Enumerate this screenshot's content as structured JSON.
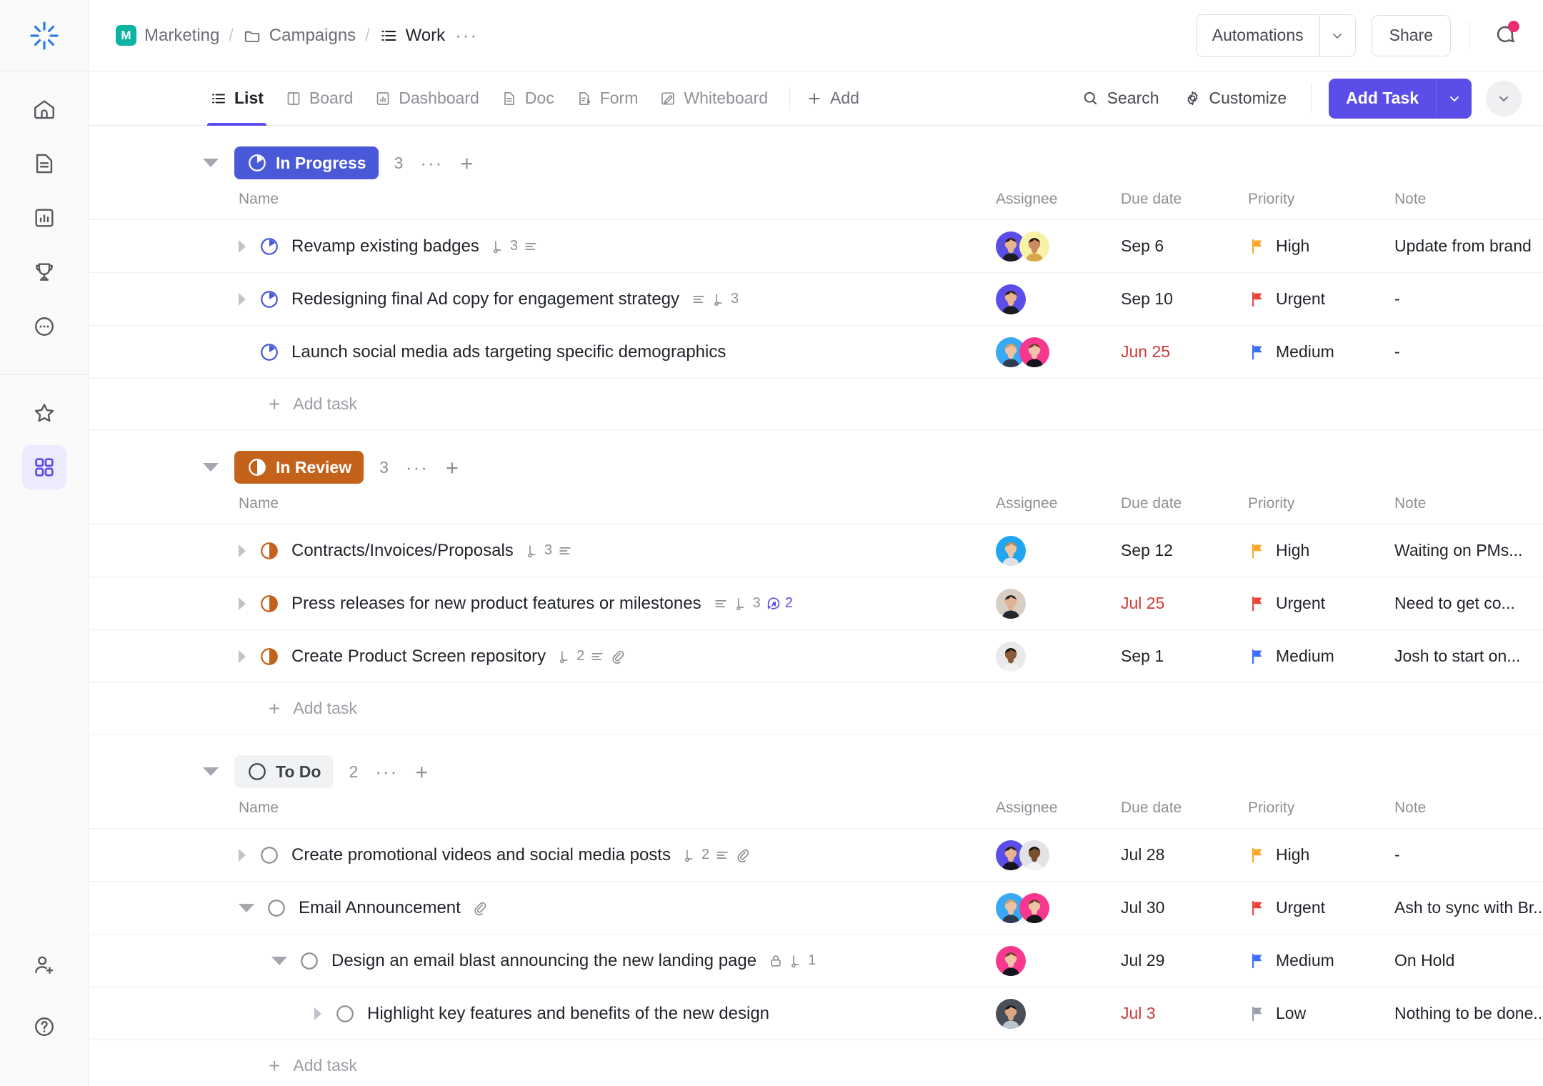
{
  "app": {
    "logo_icon": "clickup-logo-icon",
    "accent": "#5b4ee8"
  },
  "rail": {
    "top_items": [
      {
        "icon": "home-icon",
        "name": "home"
      },
      {
        "icon": "docs-icon",
        "name": "docs"
      },
      {
        "icon": "dashboards-icon",
        "name": "dashboards"
      },
      {
        "icon": "goals-trophy-icon",
        "name": "goals"
      },
      {
        "icon": "more-circle-icon",
        "name": "more"
      }
    ],
    "bottom_group": [
      {
        "icon": "star-icon",
        "name": "favorites",
        "active": false
      },
      {
        "icon": "apps-grid-icon",
        "name": "apps",
        "active": true
      }
    ],
    "footer_items": [
      {
        "icon": "invite-user-icon",
        "name": "invite"
      },
      {
        "icon": "help-circle-icon",
        "name": "help"
      }
    ]
  },
  "breadcrumb": {
    "space_initial": "M",
    "space": "Marketing",
    "folder_icon": "folder-icon",
    "folder": "Campaigns",
    "list_icon": "list-icon",
    "list": "Work",
    "more": "···",
    "separator": "/"
  },
  "topbar": {
    "automations_label": "Automations",
    "automations_caret_icon": "chevron-down-icon",
    "share_label": "Share",
    "notification_icon": "notification-bell-icon",
    "notification_dot_color": "#eb2f72"
  },
  "viewbar": {
    "tabs": [
      {
        "label": "List",
        "icon": "list-view-icon",
        "active": true
      },
      {
        "label": "Board",
        "icon": "board-view-icon",
        "active": false
      },
      {
        "label": "Dashboard",
        "icon": "dashboard-view-icon",
        "active": false
      },
      {
        "label": "Doc",
        "icon": "doc-view-icon",
        "active": false
      },
      {
        "label": "Form",
        "icon": "form-view-icon",
        "active": false
      },
      {
        "label": "Whiteboard",
        "icon": "whiteboard-view-icon",
        "active": false
      }
    ],
    "add_label": "Add",
    "add_icon": "plus-icon",
    "search_label": "Search",
    "search_icon": "search-icon",
    "customize_label": "Customize",
    "customize_icon": "gear-icon",
    "add_task_label": "Add Task",
    "add_task_caret_icon": "chevron-down-icon",
    "overflow_caret_icon": "chevron-down-icon"
  },
  "columns": {
    "name": "Name",
    "assignee": "Assignee",
    "due_date": "Due date",
    "priority": "Priority",
    "note": "Note"
  },
  "add_task_row_label": "Add task",
  "groups": [
    {
      "status": "In Progress",
      "status_color": "#4a59d8",
      "status_text_color": "#ffffff",
      "status_icon": "pie-progress-icon",
      "count": "3",
      "tasks": [
        {
          "title": "Revamp existing badges",
          "indent": 0,
          "caret": "closed",
          "status_icon": "pie-progress-icon",
          "status_color": "#4a59d8",
          "meta": [
            {
              "icon": "subtask-icon",
              "value": "3"
            },
            {
              "icon": "description-icon",
              "value": ""
            }
          ],
          "assignees": [
            {
              "bg": "#5b4ee8",
              "hair": "#2a1f16",
              "skin": "#e8b48f",
              "shirt": "#1b1b22"
            },
            {
              "bg": "#f6f2a8",
              "hair": "#241711",
              "skin": "#c98b5e",
              "shirt": "#d7a64f"
            }
          ],
          "due": "Sep 6",
          "overdue": false,
          "priority": "High",
          "priority_color": "#ffa726",
          "note": "Update from brand"
        },
        {
          "title": "Redesigning final Ad copy for engagement strategy",
          "indent": 0,
          "caret": "closed",
          "status_icon": "pie-progress-icon",
          "status_color": "#4a59d8",
          "meta": [
            {
              "icon": "description-icon",
              "value": ""
            },
            {
              "icon": "subtask-icon",
              "value": "3"
            }
          ],
          "assignees": [
            {
              "bg": "#5b4ee8",
              "hair": "#2a1f16",
              "skin": "#e8b48f",
              "shirt": "#1b1b22"
            }
          ],
          "due": "Sep 10",
          "overdue": false,
          "priority": "Urgent",
          "priority_color": "#e8433b",
          "note": "-"
        },
        {
          "title": "Launch social media ads targeting specific demographics",
          "indent": 0,
          "caret": "none",
          "status_icon": "pie-progress-icon",
          "status_color": "#4a59d8",
          "meta": [],
          "assignees": [
            {
              "bg": "#39a9f5",
              "hair": "#c9a06a",
              "skin": "#eec2a0",
              "shirt": "#2f3b52"
            },
            {
              "bg": "#f8378f",
              "hair": "#6b4226",
              "skin": "#f0c3a6",
              "shirt": "#15151b"
            }
          ],
          "due": "Jun 25",
          "overdue": true,
          "priority": "Medium",
          "priority_color": "#3b6ef5",
          "note": "-"
        }
      ]
    },
    {
      "status": "In Review",
      "status_color": "#c4621b",
      "status_text_color": "#ffffff",
      "status_icon": "half-circle-icon",
      "count": "3",
      "tasks": [
        {
          "title": "Contracts/Invoices/Proposals",
          "indent": 0,
          "caret": "closed",
          "status_icon": "half-circle-icon",
          "status_color": "#c4621b",
          "meta": [
            {
              "icon": "subtask-icon",
              "value": "3"
            },
            {
              "icon": "description-icon",
              "value": ""
            }
          ],
          "assignees": [
            {
              "bg": "#1fa5f2",
              "hair": "#b48a5c",
              "skin": "#f0c3a0",
              "shirt": "#dfe3e8"
            }
          ],
          "due": "Sep 12",
          "overdue": false,
          "priority": "High",
          "priority_color": "#ffa726",
          "note": "Waiting on PMs..."
        },
        {
          "title": "Press releases for new product features or milestones",
          "indent": 0,
          "caret": "closed",
          "status_icon": "half-circle-icon",
          "status_color": "#c4621b",
          "meta": [
            {
              "icon": "description-icon",
              "value": ""
            },
            {
              "icon": "subtask-icon",
              "value": "3"
            },
            {
              "icon": "mention-icon",
              "value": "2"
            }
          ],
          "assignees": [
            {
              "bg": "#d8cfc4",
              "hair": "#2e2118",
              "skin": "#e2b292",
              "shirt": "#222730"
            }
          ],
          "due": "Jul 25",
          "overdue": true,
          "priority": "Urgent",
          "priority_color": "#e8433b",
          "note": "Need to get co..."
        },
        {
          "title": "Create Product Screen repository",
          "indent": 0,
          "caret": "closed",
          "status_icon": "half-circle-icon",
          "status_color": "#c4621b",
          "meta": [
            {
              "icon": "subtask-icon",
              "value": "2"
            },
            {
              "icon": "description-icon",
              "value": ""
            },
            {
              "icon": "attachment-icon",
              "value": ""
            }
          ],
          "assignees": [
            {
              "bg": "#e9e9ec",
              "hair": "#15100c",
              "skin": "#8a5a3a",
              "shirt": "#f2f2f4"
            }
          ],
          "due": "Sep 1",
          "overdue": false,
          "priority": "Medium",
          "priority_color": "#3b6ef5",
          "note": "Josh to start on..."
        }
      ]
    },
    {
      "status": "To Do",
      "status_color": "#f1f2f4",
      "status_text_color": "#3d4149",
      "status_icon": "empty-circle-icon",
      "count": "2",
      "tasks": [
        {
          "title": "Create promotional videos and social media posts",
          "indent": 0,
          "caret": "closed",
          "status_icon": "empty-circle-icon",
          "status_color": "#8d9096",
          "meta": [
            {
              "icon": "subtask-icon",
              "value": "2"
            },
            {
              "icon": "description-icon",
              "value": ""
            },
            {
              "icon": "attachment-icon",
              "value": ""
            }
          ],
          "assignees": [
            {
              "bg": "#5b4ee8",
              "hair": "#241a12",
              "skin": "#e8b48f",
              "shirt": "#15151b"
            },
            {
              "bg": "#e3e3e7",
              "hair": "#1a120c",
              "skin": "#7a4f30",
              "shirt": "#f4f4f6"
            }
          ],
          "due": "Jul 28",
          "overdue": false,
          "priority": "High",
          "priority_color": "#ffa726",
          "note": "-"
        },
        {
          "title": "Email Announcement",
          "indent": 0,
          "caret": "open",
          "status_icon": "empty-circle-icon",
          "status_color": "#8d9096",
          "meta": [
            {
              "icon": "attachment-icon",
              "value": ""
            }
          ],
          "assignees": [
            {
              "bg": "#39a9f5",
              "hair": "#c9a06a",
              "skin": "#eec2a0",
              "shirt": "#2f3b52"
            },
            {
              "bg": "#f8378f",
              "hair": "#6b4226",
              "skin": "#f0c3a6",
              "shirt": "#15151b"
            }
          ],
          "due": "Jul 30",
          "overdue": false,
          "priority": "Urgent",
          "priority_color": "#e8433b",
          "note": "Ash to sync with Br..."
        },
        {
          "title": "Design an email blast announcing the new landing page",
          "indent": 1,
          "caret": "open",
          "status_icon": "empty-circle-icon",
          "status_color": "#8d9096",
          "meta": [
            {
              "icon": "lock-icon",
              "value": ""
            },
            {
              "icon": "subtask-icon",
              "value": "1"
            }
          ],
          "assignees": [
            {
              "bg": "#f8378f",
              "hair": "#6b4226",
              "skin": "#f0c3a6",
              "shirt": "#15151b"
            }
          ],
          "due": "Jul 29",
          "overdue": false,
          "priority": "Medium",
          "priority_color": "#3b6ef5",
          "note": "On Hold"
        },
        {
          "title": "Highlight key features and benefits of the new design",
          "indent": 2,
          "caret": "closed",
          "status_icon": "empty-circle-icon",
          "status_color": "#8d9096",
          "meta": [],
          "assignees": [
            {
              "bg": "#4a4e59",
              "hair": "#191414",
              "skin": "#d9a683",
              "shirt": "#b9c4cf"
            }
          ],
          "due": "Jul 3",
          "overdue": true,
          "priority": "Low",
          "priority_color": "#9aa0a8",
          "note": "Nothing to be done..."
        }
      ]
    }
  ]
}
